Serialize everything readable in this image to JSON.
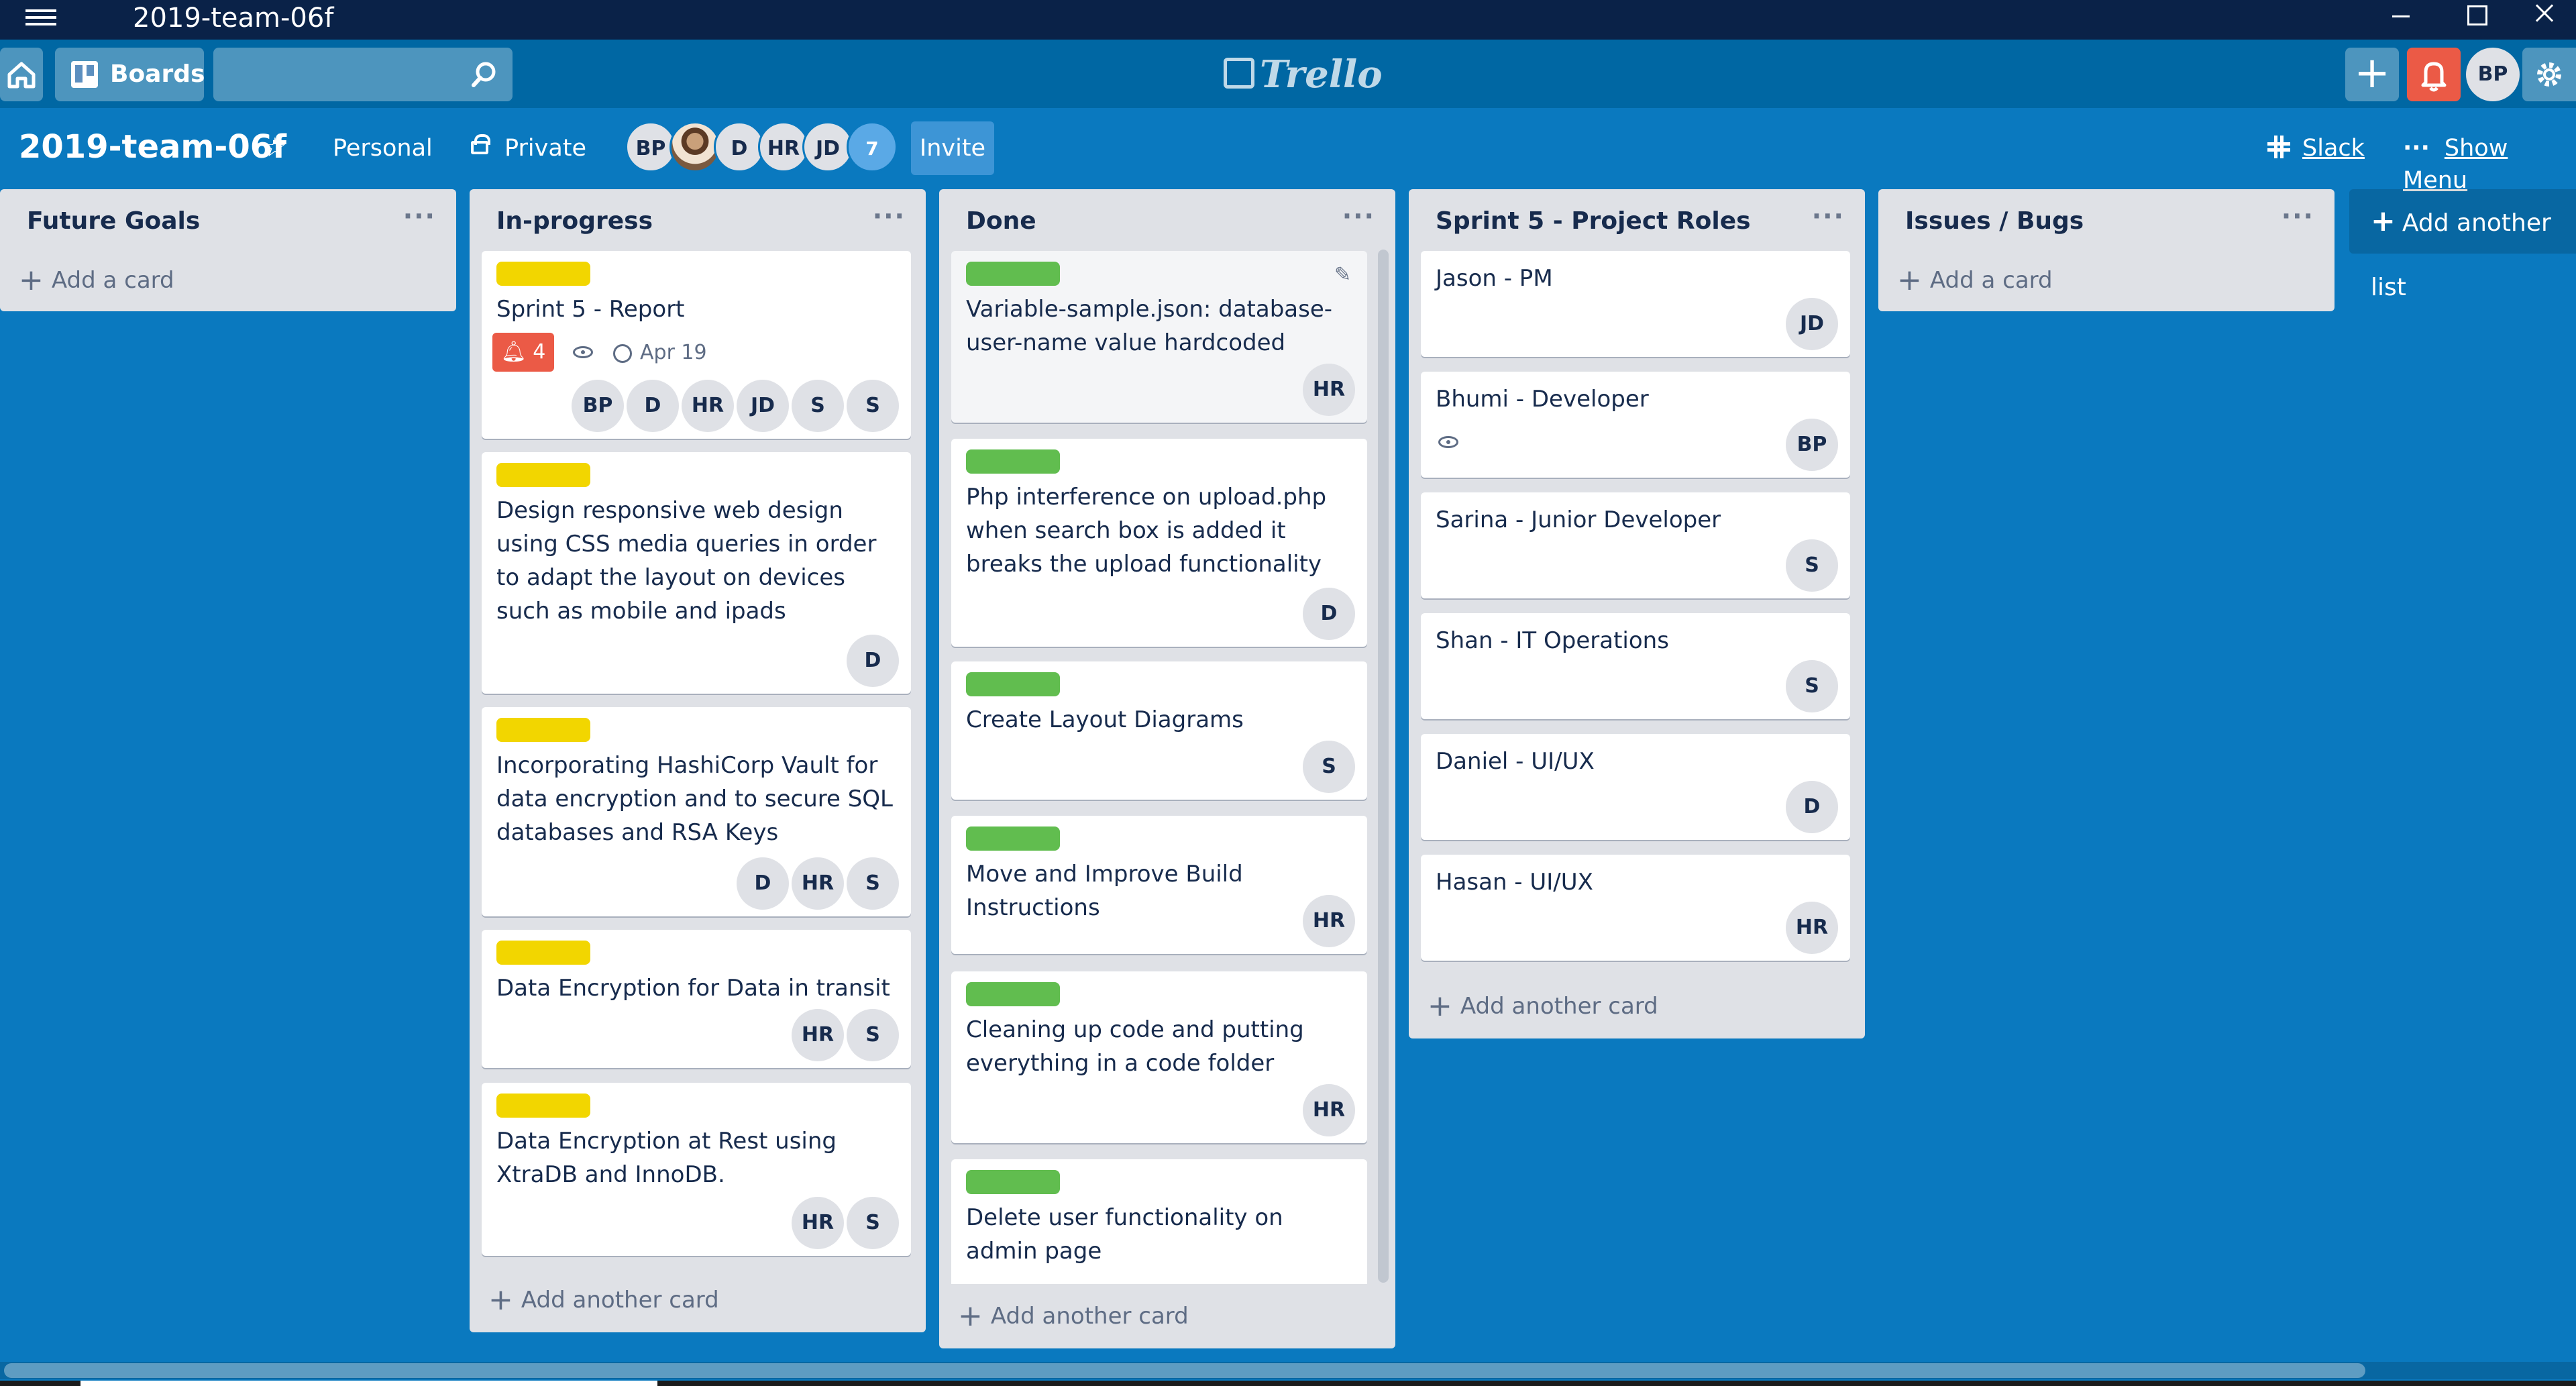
{
  "window": {
    "title": "2019-team-06f"
  },
  "header": {
    "boards_label": "Boards",
    "logo_text": "Trello",
    "user_initials": "BP"
  },
  "board": {
    "title": "2019-team-06f",
    "team": "Personal",
    "visibility": "Private",
    "members": [
      "BP",
      "",
      "D",
      "HR",
      "JD"
    ],
    "member_count": "7",
    "invite_label": "Invite",
    "slack_label": "Slack",
    "menu_label": "Show Menu"
  },
  "lists": [
    {
      "title": "Future Goals",
      "add_label": "Add a card"
    },
    {
      "title": "In-progress",
      "add_label": "Add another card",
      "cards": [
        {
          "text": "Sprint 5 - Report",
          "notifications": "4",
          "due": "Apr 19",
          "members": [
            "BP",
            "D",
            "HR",
            "JD",
            "S",
            "S"
          ]
        },
        {
          "text": "Design responsive web design using CSS media queries in order to adapt the layout on devices such as mobile and ipads",
          "members": [
            "D"
          ]
        },
        {
          "text": "Incorporating HashiCorp Vault for data encryption and to secure SQL databases and RSA Keys",
          "members": [
            "D",
            "HR",
            "S"
          ]
        },
        {
          "text": "Data Encryption for Data in transit",
          "members": [
            "HR",
            "S"
          ]
        },
        {
          "text": "Data Encryption at Rest using XtraDB and InnoDB.",
          "members": [
            "HR",
            "S"
          ]
        }
      ]
    },
    {
      "title": "Done",
      "add_label": "Add another card",
      "cards": [
        {
          "text": "Variable-sample.json: database-user-name value hardcoded",
          "members": [
            "HR"
          ]
        },
        {
          "text": "Php interference on upload.php when search box is added it breaks the upload functionality",
          "members": [
            "D"
          ]
        },
        {
          "text": "Create Layout Diagrams",
          "members": [
            "S"
          ]
        },
        {
          "text": "Move and Improve Build Instructions",
          "members": [
            "HR"
          ]
        },
        {
          "text": "Cleaning up code and putting everything in a code folder",
          "members": [
            "HR"
          ]
        },
        {
          "text": "Delete user functionality on admin page",
          "members": []
        }
      ]
    },
    {
      "title": "Sprint 5 - Project Roles",
      "add_label": "Add another card",
      "cards": [
        {
          "text": "Jason - PM",
          "members": [
            "JD"
          ]
        },
        {
          "text": "Bhumi - Developer",
          "members": [
            "BP"
          ]
        },
        {
          "text": "Sarina - Junior Developer",
          "members": [
            "S"
          ]
        },
        {
          "text": "Shan - IT Operations",
          "members": [
            "S"
          ]
        },
        {
          "text": "Daniel - UI/UX",
          "members": [
            "D"
          ]
        },
        {
          "text": "Hasan - UI/UX",
          "members": [
            "HR"
          ]
        }
      ]
    },
    {
      "title": "Issues / Bugs",
      "add_label": "Add a card"
    }
  ],
  "add_list_label": "Add another list",
  "colors": {
    "board_bg": "#0a79bf",
    "label_yellow": "#f2d600",
    "label_green": "#61bd4f",
    "notification": "#eb5a46"
  },
  "icons": [
    "menu-icon",
    "home-icon",
    "boards-icon",
    "search-icon",
    "plus-icon",
    "bell-icon",
    "gear-icon",
    "star-icon",
    "lock-icon",
    "slack-icon",
    "eye-icon",
    "clock-icon",
    "pencil-icon"
  ]
}
